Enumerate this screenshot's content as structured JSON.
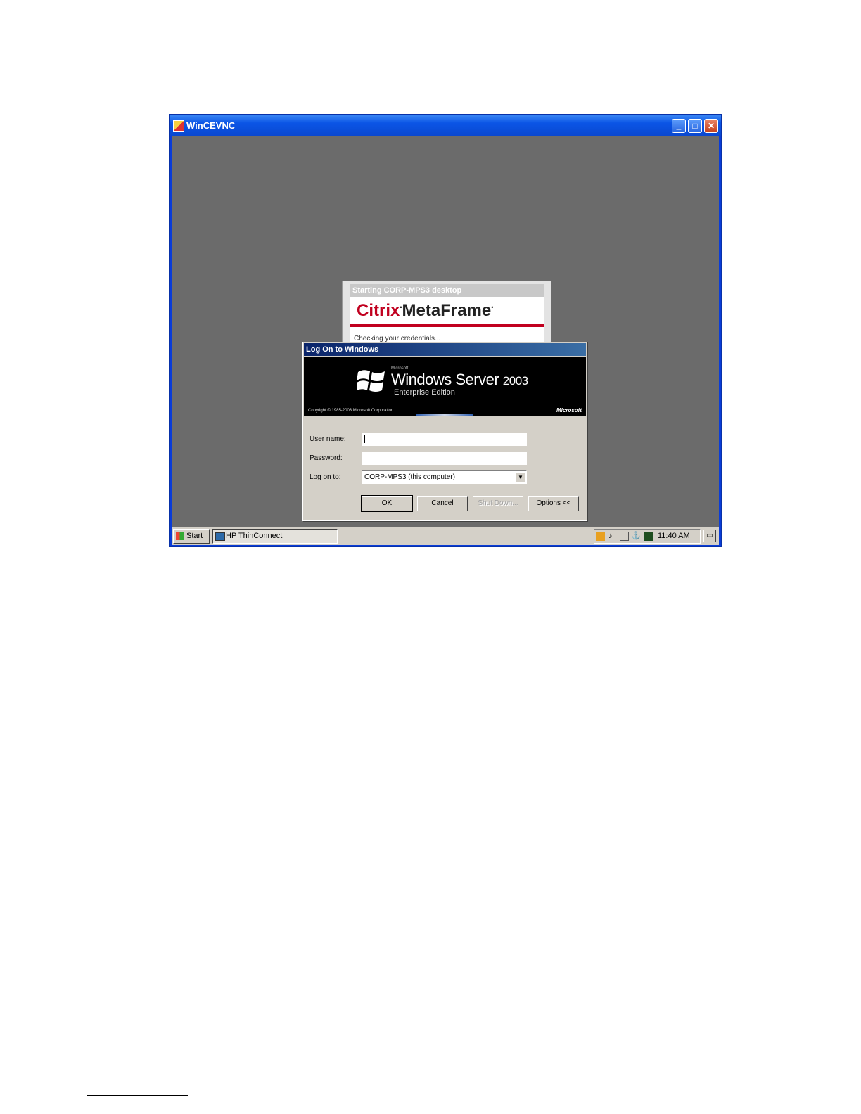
{
  "window": {
    "title": "WinCEVNC"
  },
  "citrix": {
    "title": "Starting CORP-MPS3 desktop",
    "brand_citrix": "Citrix",
    "brand_product": "MetaFrame",
    "status": "Checking your credentials..."
  },
  "logon": {
    "title": "Log On to Windows",
    "banner": {
      "microsoft_small": "Microsoft",
      "product": "Windows Server",
      "year": "2003",
      "edition": "Enterprise Edition",
      "copyright": "Copyright © 1985-2003  Microsoft Corporation",
      "ms_logo": "Microsoft"
    },
    "username_label": "User name:",
    "username_value": "",
    "password_label": "Password:",
    "password_value": "",
    "logon_to_label": "Log on to:",
    "logon_to_value": "CORP-MPS3 (this computer)",
    "buttons": {
      "ok": "OK",
      "cancel": "Cancel",
      "shutdown": "Shut Down...",
      "options": "Options <<"
    }
  },
  "taskbar": {
    "start": "Start",
    "task": "HP ThinConnect",
    "clock": "11:40 AM",
    "tray_icons": [
      "network-icon",
      "volume-icon",
      "connection-icon",
      "usb-icon",
      "monitor-icon"
    ]
  },
  "colors": {
    "title_blue": "#0b55e6",
    "desktop_gray": "#6b6b6b",
    "citrix_red": "#c1001f",
    "dialog_face": "#d4d0c8"
  }
}
